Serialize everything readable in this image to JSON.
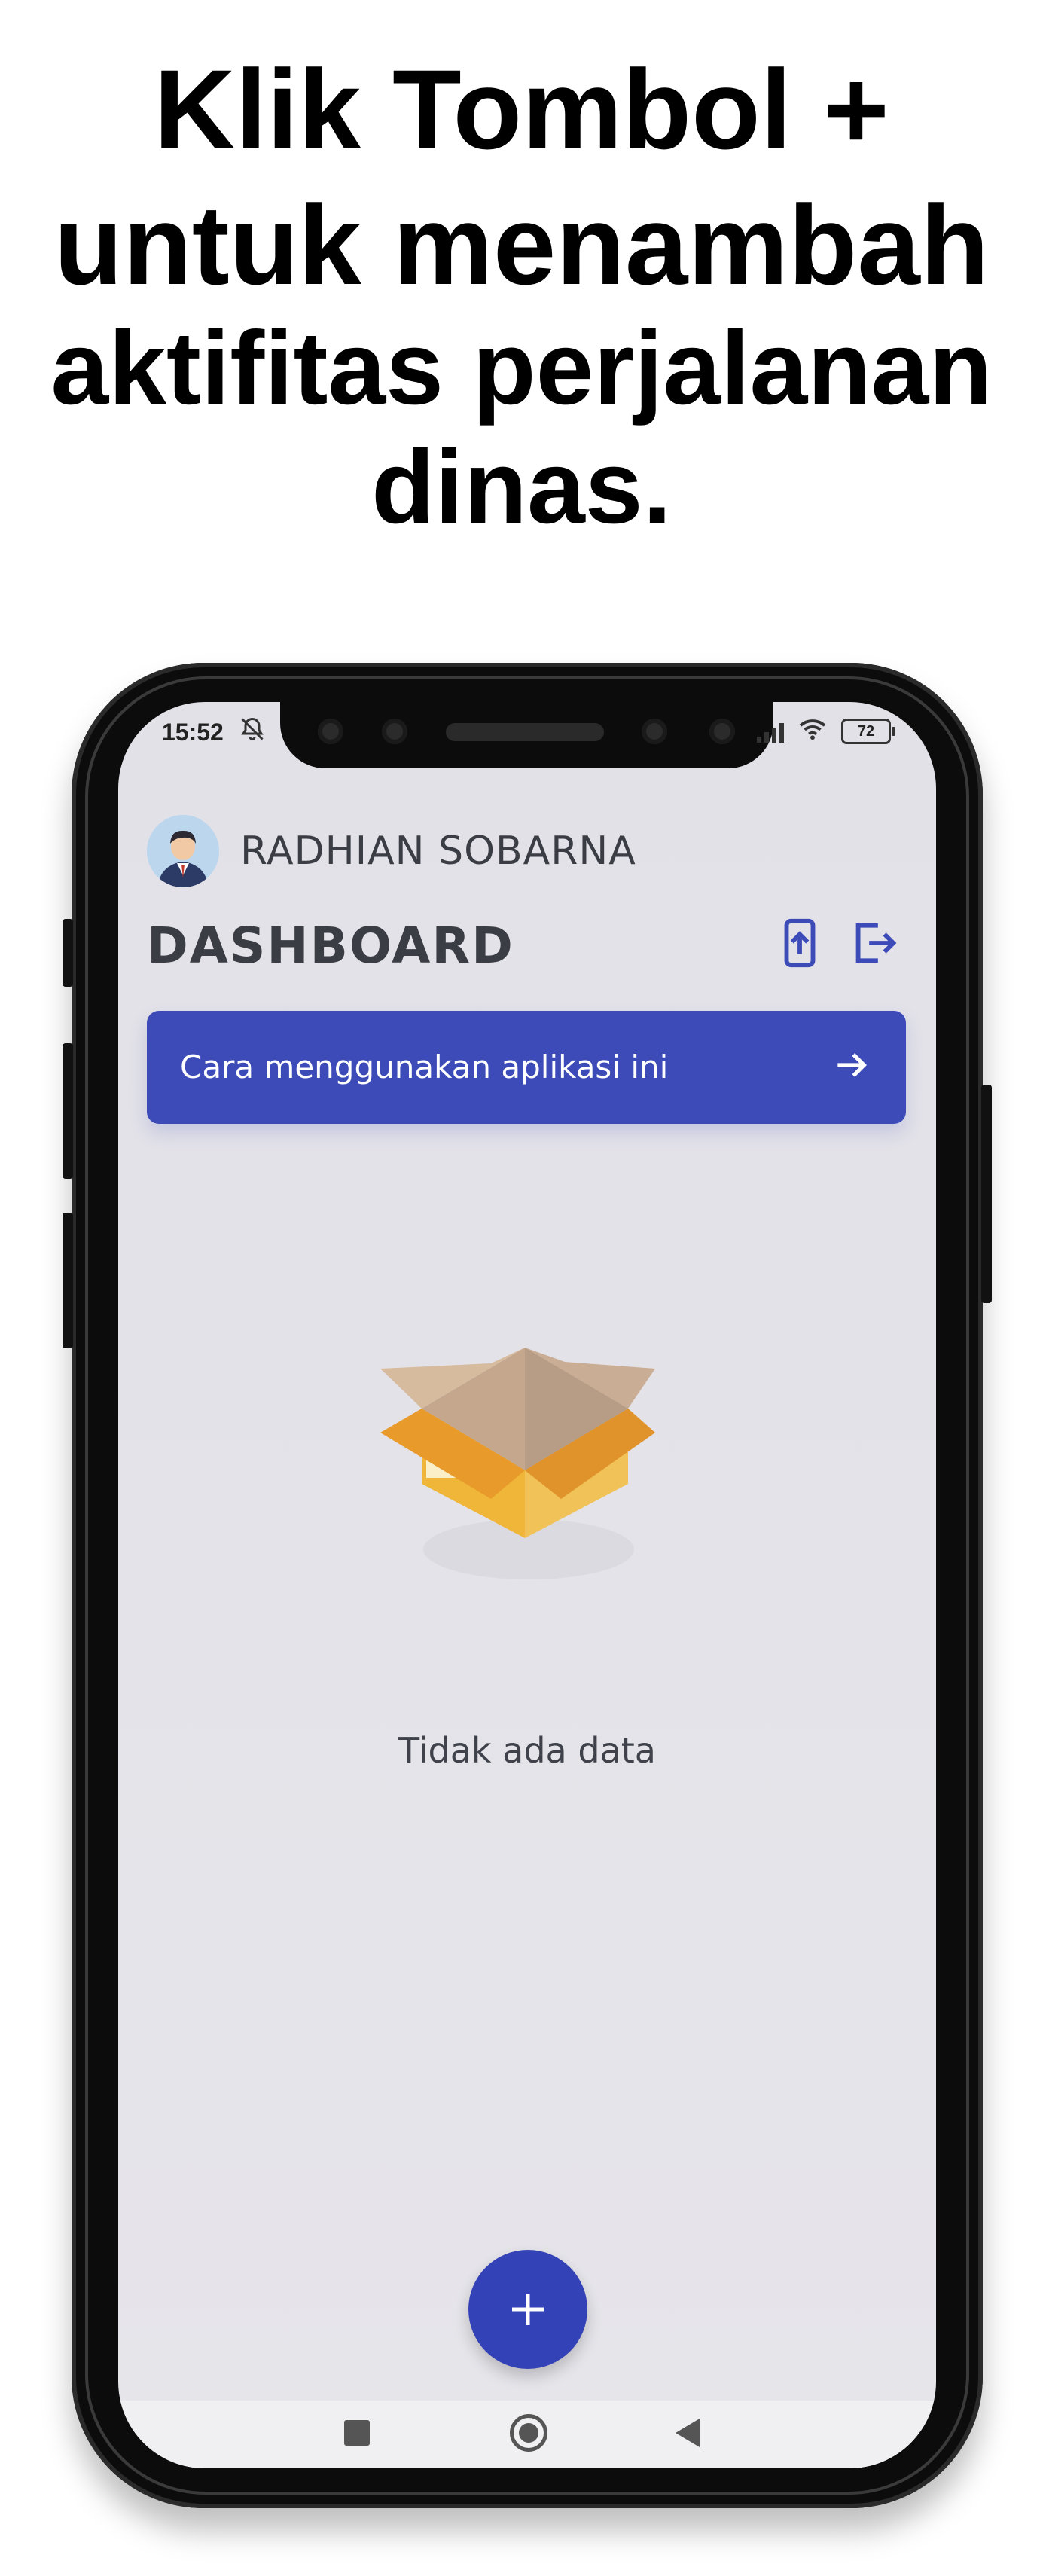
{
  "headline": {
    "line1": "Klik Tombol +",
    "line2": "untuk menambah",
    "line3": "aktifitas perjalanan",
    "line4": "dinas."
  },
  "status_bar": {
    "time": "15:52",
    "battery": "72",
    "icons": [
      "bell-off-icon",
      "signal-icon",
      "wifi-icon",
      "battery-icon"
    ]
  },
  "profile": {
    "name": "RADHIAN SOBARNA"
  },
  "dashboard": {
    "title": "DASHBOARD",
    "actions": [
      "upload-phone-icon",
      "logout-icon"
    ]
  },
  "tutorial_banner": {
    "label": "Cara menggunakan aplikasi ini"
  },
  "empty_state": {
    "message": "Tidak ada data",
    "icon": "open-box-icon"
  },
  "fab": {
    "label": "+"
  },
  "colors": {
    "primary": "#3d4bb9",
    "fab": "#3442b7",
    "screen_bg": "#e3e2e8",
    "text_dark": "#3a3d44",
    "box_orange": "#e89a2a",
    "box_yellow": "#f1c257"
  },
  "nav_bar": [
    "recent-apps-icon",
    "home-icon",
    "back-icon"
  ]
}
